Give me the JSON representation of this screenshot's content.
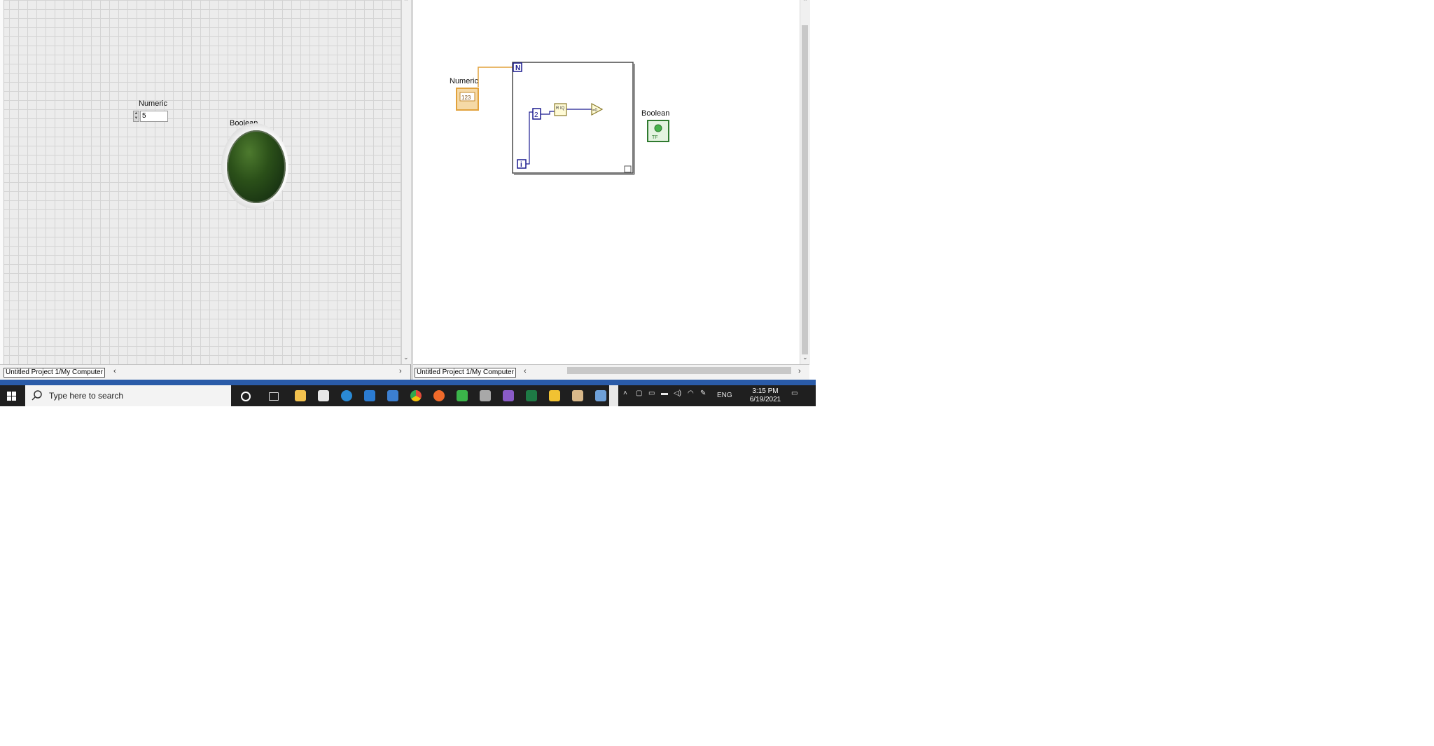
{
  "front_panel": {
    "numeric_label": "Numeric",
    "numeric_value": "5",
    "boolean_label": "Boolean",
    "status_context": "Untitled Project 1/My Computer",
    "led_color": "#2b5019"
  },
  "block_diagram": {
    "numeric_label": "Numeric",
    "numeric_terminal": "123",
    "boolean_label": "Boolean",
    "boolean_terminal": "TF",
    "loop_count_terminal": "N",
    "iteration_terminal": "i",
    "constant_value": "2",
    "quotient_node": "R IQ",
    "status_context": "Untitled Project 1/My Computer"
  },
  "taskbar": {
    "search_placeholder": "Type here to search",
    "language": "ENG",
    "time": "3:15 PM",
    "date": "6/19/2021",
    "icons": [
      "cortana-icon",
      "task-view-icon",
      "file-explorer-icon",
      "store-icon",
      "edge-icon",
      "vscode-icon",
      "mail-icon",
      "chrome-icon",
      "app-orange-icon",
      "app-green-icon",
      "tools-icon",
      "visual-studio-icon",
      "excel-icon",
      "labview-icon",
      "folder-image-icon",
      "control-panel-icon"
    ]
  },
  "colors": {
    "wire_numeric": "#e2a23c",
    "wire_boolean": "#2f7a2f",
    "loop_border": "#555555",
    "taskbar": "#1f1f1f",
    "accent_blue": "#2a5ba8"
  }
}
